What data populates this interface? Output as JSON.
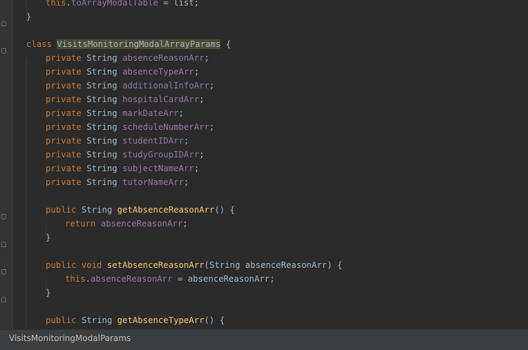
{
  "editor": {
    "lines": [
      {
        "indent": 1,
        "tokens": [
          {
            "t": "this",
            "c": "kw"
          },
          {
            "t": "."
          },
          {
            "t": "toArrayModalTable",
            "c": "fld"
          },
          {
            "t": " = list;"
          }
        ]
      },
      {
        "indent": 0,
        "tokens": [
          {
            "t": "}"
          }
        ]
      },
      {
        "indent": 0,
        "tokens": []
      },
      {
        "indent": 0,
        "tokens": [
          {
            "t": "class ",
            "c": "kw"
          },
          {
            "t": "VisitsMonitoringModalArrayParams",
            "c": "hl"
          },
          {
            "t": " {"
          }
        ]
      },
      {
        "indent": 1,
        "tokens": [
          {
            "t": "private ",
            "c": "kw"
          },
          {
            "t": "String "
          },
          {
            "t": "absenceReasonArr",
            "c": "fld"
          },
          {
            "t": ";"
          }
        ]
      },
      {
        "indent": 1,
        "tokens": [
          {
            "t": "private ",
            "c": "kw"
          },
          {
            "t": "String "
          },
          {
            "t": "absenceTypeArr",
            "c": "fld"
          },
          {
            "t": ";"
          }
        ]
      },
      {
        "indent": 1,
        "tokens": [
          {
            "t": "private ",
            "c": "kw"
          },
          {
            "t": "String "
          },
          {
            "t": "additionalInfoArr",
            "c": "fld"
          },
          {
            "t": ";"
          }
        ]
      },
      {
        "indent": 1,
        "tokens": [
          {
            "t": "private ",
            "c": "kw"
          },
          {
            "t": "String "
          },
          {
            "t": "hospitalCardArr",
            "c": "fld"
          },
          {
            "t": ";"
          }
        ]
      },
      {
        "indent": 1,
        "tokens": [
          {
            "t": "private ",
            "c": "kw"
          },
          {
            "t": "String "
          },
          {
            "t": "markDateArr",
            "c": "fld"
          },
          {
            "t": ";"
          }
        ]
      },
      {
        "indent": 1,
        "tokens": [
          {
            "t": "private ",
            "c": "kw"
          },
          {
            "t": "String "
          },
          {
            "t": "scheduleNumberArr",
            "c": "fld"
          },
          {
            "t": ";"
          }
        ]
      },
      {
        "indent": 1,
        "tokens": [
          {
            "t": "private ",
            "c": "kw"
          },
          {
            "t": "String "
          },
          {
            "t": "studentIDArr",
            "c": "fld"
          },
          {
            "t": ";"
          }
        ]
      },
      {
        "indent": 1,
        "tokens": [
          {
            "t": "private ",
            "c": "kw"
          },
          {
            "t": "String "
          },
          {
            "t": "studyGroupIDArr",
            "c": "fld"
          },
          {
            "t": ";"
          }
        ]
      },
      {
        "indent": 1,
        "tokens": [
          {
            "t": "private ",
            "c": "kw"
          },
          {
            "t": "String "
          },
          {
            "t": "subjectNameArr",
            "c": "fld"
          },
          {
            "t": ";"
          }
        ]
      },
      {
        "indent": 1,
        "tokens": [
          {
            "t": "private ",
            "c": "kw"
          },
          {
            "t": "String "
          },
          {
            "t": "tutorNameArr",
            "c": "fld"
          },
          {
            "t": ";"
          }
        ]
      },
      {
        "indent": 0,
        "tokens": []
      },
      {
        "indent": 1,
        "tokens": [
          {
            "t": "public ",
            "c": "kw"
          },
          {
            "t": "String "
          },
          {
            "t": "getAbsenceReasonArr",
            "c": "mth"
          },
          {
            "t": "() {"
          }
        ]
      },
      {
        "indent": 2,
        "tokens": [
          {
            "t": "return ",
            "c": "kw"
          },
          {
            "t": "absenceReasonArr",
            "c": "fld"
          },
          {
            "t": ";"
          }
        ]
      },
      {
        "indent": 1,
        "tokens": [
          {
            "t": "}"
          }
        ]
      },
      {
        "indent": 0,
        "tokens": []
      },
      {
        "indent": 1,
        "tokens": [
          {
            "t": "public ",
            "c": "kw"
          },
          {
            "t": "void ",
            "c": "kw"
          },
          {
            "t": "setAbsenceReasonArr",
            "c": "mth"
          },
          {
            "t": "(String absenceReasonArr) {"
          }
        ]
      },
      {
        "indent": 2,
        "tokens": [
          {
            "t": "this",
            "c": "kw"
          },
          {
            "t": "."
          },
          {
            "t": "absenceReasonArr",
            "c": "fld"
          },
          {
            "t": " = absenceReasonArr;"
          }
        ]
      },
      {
        "indent": 1,
        "tokens": [
          {
            "t": "}"
          }
        ]
      },
      {
        "indent": 0,
        "tokens": []
      },
      {
        "indent": 1,
        "tokens": [
          {
            "t": "public ",
            "c": "kw"
          },
          {
            "t": "String "
          },
          {
            "t": "getAbsenceTypeArr",
            "c": "mth"
          },
          {
            "t": "() {"
          }
        ]
      }
    ]
  },
  "statusbar": {
    "breadcrumb": "VisitsMonitoringModalParams"
  }
}
